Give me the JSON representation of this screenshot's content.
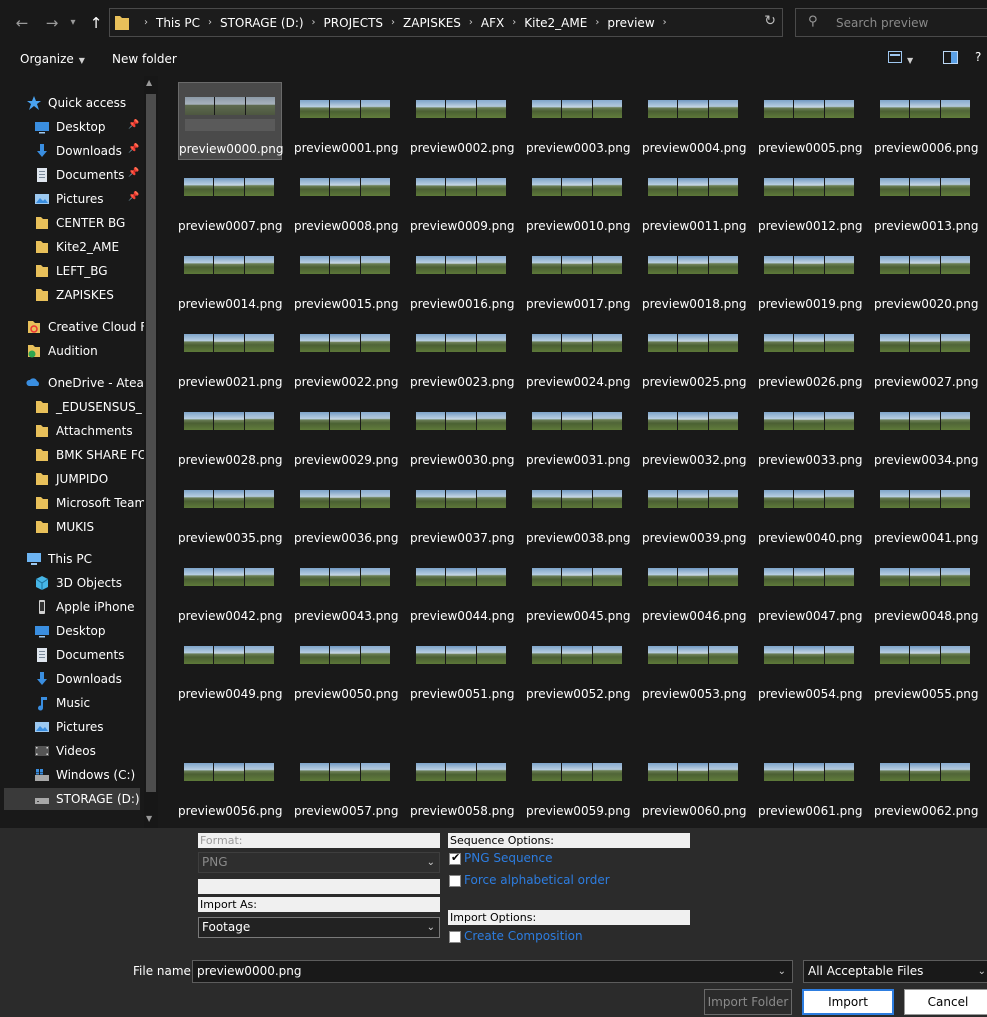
{
  "breadcrumbs": [
    "This PC",
    "STORAGE (D:)",
    "PROJECTS",
    "ZAPISKES",
    "AFX",
    "Kite2_AME",
    "preview"
  ],
  "search": {
    "placeholder": "Search preview"
  },
  "toolbar": {
    "organize": "Organize",
    "new_folder": "New folder"
  },
  "nav": {
    "items": [
      {
        "label": "Quick access",
        "icon": "star-icon",
        "level": 0,
        "pinned": false
      },
      {
        "label": "Desktop",
        "icon": "desktop-icon",
        "level": 1,
        "pinned": true
      },
      {
        "label": "Downloads",
        "icon": "download-icon",
        "level": 1,
        "pinned": true
      },
      {
        "label": "Documents",
        "icon": "documents-icon",
        "level": 1,
        "pinned": true
      },
      {
        "label": "Pictures",
        "icon": "pictures-icon",
        "level": 1,
        "pinned": true
      },
      {
        "label": "CENTER BG",
        "icon": "folder-icon",
        "level": 1,
        "pinned": false
      },
      {
        "label": "Kite2_AME",
        "icon": "folder-icon",
        "level": 1,
        "pinned": false
      },
      {
        "label": "LEFT_BG",
        "icon": "folder-icon",
        "level": 1,
        "pinned": false
      },
      {
        "label": "ZAPISKES",
        "icon": "folder-icon",
        "level": 1,
        "pinned": false
      },
      {
        "label": "Creative Cloud Fil",
        "icon": "creative-cloud-icon",
        "level": 0,
        "pinned": false
      },
      {
        "label": "Audition",
        "icon": "audition-folder-icon",
        "level": 0,
        "pinned": false
      },
      {
        "label": "OneDrive - Atea",
        "icon": "onedrive-icon",
        "level": 0,
        "pinned": false
      },
      {
        "label": "_EDUSENSUS_",
        "icon": "folder-icon",
        "level": 1,
        "pinned": false
      },
      {
        "label": "Attachments",
        "icon": "folder-icon",
        "level": 1,
        "pinned": false
      },
      {
        "label": "BMK SHARE FOL",
        "icon": "folder-icon",
        "level": 1,
        "pinned": false
      },
      {
        "label": "JUMPIDO",
        "icon": "folder-icon",
        "level": 1,
        "pinned": false
      },
      {
        "label": "Microsoft Teams",
        "icon": "folder-icon",
        "level": 1,
        "pinned": false
      },
      {
        "label": "MUKIS",
        "icon": "folder-icon",
        "level": 1,
        "pinned": false
      },
      {
        "label": "This PC",
        "icon": "this-pc-icon",
        "level": 0,
        "pinned": false
      },
      {
        "label": "3D Objects",
        "icon": "3d-objects-icon",
        "level": 1,
        "pinned": false
      },
      {
        "label": "Apple iPhone",
        "icon": "iphone-icon",
        "level": 1,
        "pinned": false
      },
      {
        "label": "Desktop",
        "icon": "desktop-icon",
        "level": 1,
        "pinned": false
      },
      {
        "label": "Documents",
        "icon": "documents-icon",
        "level": 1,
        "pinned": false
      },
      {
        "label": "Downloads",
        "icon": "download-icon",
        "level": 1,
        "pinned": false
      },
      {
        "label": "Music",
        "icon": "music-icon",
        "level": 1,
        "pinned": false
      },
      {
        "label": "Pictures",
        "icon": "pictures-icon",
        "level": 1,
        "pinned": false
      },
      {
        "label": "Videos",
        "icon": "videos-icon",
        "level": 1,
        "pinned": false
      },
      {
        "label": "Windows (C:)",
        "icon": "windows-drive-icon",
        "level": 1,
        "pinned": false
      },
      {
        "label": "STORAGE (D:)",
        "icon": "drive-icon",
        "level": 1,
        "pinned": false,
        "selected": true
      }
    ]
  },
  "files": {
    "selected": "preview0000.png",
    "names": [
      "preview0000.png",
      "preview0001.png",
      "preview0002.png",
      "preview0003.png",
      "preview0004.png",
      "preview0005.png",
      "preview0006.png",
      "preview0007.png",
      "preview0008.png",
      "preview0009.png",
      "preview0010.png",
      "preview0011.png",
      "preview0012.png",
      "preview0013.png",
      "preview0014.png",
      "preview0015.png",
      "preview0016.png",
      "preview0017.png",
      "preview0018.png",
      "preview0019.png",
      "preview0020.png",
      "preview0021.png",
      "preview0022.png",
      "preview0023.png",
      "preview0024.png",
      "preview0025.png",
      "preview0026.png",
      "preview0027.png",
      "preview0028.png",
      "preview0029.png",
      "preview0030.png",
      "preview0031.png",
      "preview0032.png",
      "preview0033.png",
      "preview0034.png",
      "preview0035.png",
      "preview0036.png",
      "preview0037.png",
      "preview0038.png",
      "preview0039.png",
      "preview0040.png",
      "preview0041.png",
      "preview0042.png",
      "preview0043.png",
      "preview0044.png",
      "preview0045.png",
      "preview0046.png",
      "preview0047.png",
      "preview0048.png",
      "preview0049.png",
      "preview0050.png",
      "preview0051.png",
      "preview0052.png",
      "preview0053.png",
      "preview0054.png",
      "preview0055.png",
      "preview0056.png",
      "preview0057.png",
      "preview0058.png",
      "preview0059.png",
      "preview0060.png",
      "preview0061.png",
      "preview0062.png"
    ]
  },
  "options": {
    "format_label": "Format:",
    "format_value": "PNG",
    "import_as_label": "Import As:",
    "import_as_value": "Footage",
    "sequence_label": "Sequence Options:",
    "png_sequence": "PNG Sequence",
    "png_sequence_checked": true,
    "force_alpha": "Force alphabetical order",
    "force_alpha_checked": false,
    "import_options_label": "Import Options:",
    "create_comp": "Create Composition",
    "create_comp_checked": false
  },
  "footer": {
    "file_name_label": "File name:",
    "file_name_value": "preview0000.png",
    "file_type": "All Acceptable Files (*.fla;*.prpr",
    "import_folder": "Import Folder",
    "import": "Import",
    "cancel": "Cancel"
  },
  "colors": {
    "accent": "#2d7de0",
    "folder": "#e8c05a",
    "background": "#191919",
    "panel": "#2b2b2b"
  }
}
